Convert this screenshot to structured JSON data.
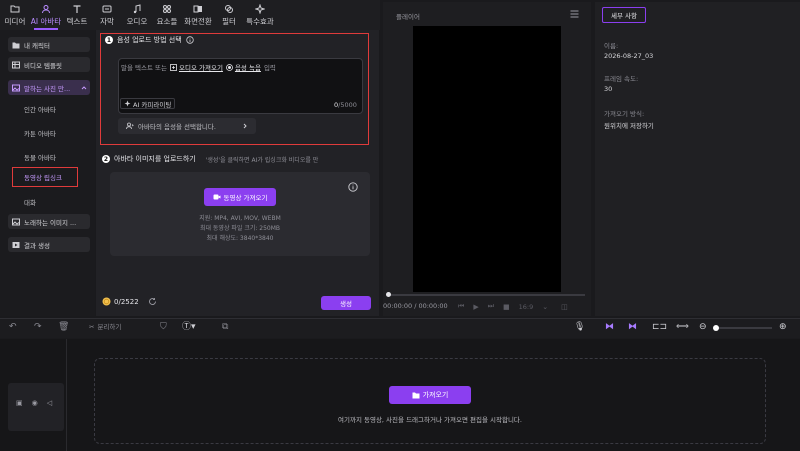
{
  "toolbar": {
    "items": [
      {
        "label": "미디어",
        "icon": "folder-icon"
      },
      {
        "label": "AI 아바타",
        "icon": "avatar-icon"
      },
      {
        "label": "텍스트",
        "icon": "text-icon"
      },
      {
        "label": "자막",
        "icon": "caption-icon"
      },
      {
        "label": "오디오",
        "icon": "music-note-icon"
      },
      {
        "label": "요소들",
        "icon": "elements-icon"
      },
      {
        "label": "화면전환",
        "icon": "transition-icon"
      },
      {
        "label": "필터",
        "icon": "filter-icon"
      },
      {
        "label": "특수효과",
        "icon": "effects-icon"
      }
    ]
  },
  "sidebar": {
    "my_character": "내 캐릭터",
    "video_template": "비디오 템플릿",
    "talking_photo": "말하는 사진 만...",
    "sub_items": [
      "인간 아바타",
      "카툰 아바타",
      "동물 아바타",
      "동영상 립싱크",
      "대화"
    ],
    "singing_image": "노래하는 이미지 ...",
    "results": "결과 생성"
  },
  "center": {
    "step1_title": "음성 업로드 방법 선택",
    "step1_num": "1",
    "step2_num": "2",
    "prompt_prefix": "말을 텍스트 또는",
    "audio_import": "오디오 가져오기",
    "record_link": "음성 녹음",
    "prompt_suffix": "입력",
    "ai_copywriting": "AI 카피라이팅",
    "char_count": "0",
    "char_limit": "/5000",
    "voice_select": "아바타의 음성을 선택합니다.",
    "step2_title": "아바타 이미지를 업로드하기",
    "step2_hint": "'생성'을 클릭하면 AI가 립싱크화 비디오를 만",
    "video_import_button": "동영상 가져오기",
    "format_info": "지원: MP4, AVI, MOV, WEBM",
    "size_info": "최대 동영상 파일 크기: 250MB",
    "resolution_info": "최대 해상도: 3840*3840",
    "credits_used": "0",
    "credits_total": "/2522",
    "generate_button": "생성"
  },
  "player": {
    "title": "플레이어",
    "time_current": "00:00:00",
    "time_total": "/ 00:00:00",
    "aspect_ratio": "16:9"
  },
  "details": {
    "tab": "세부 사항",
    "name_label": "이름:",
    "name_value": "2026-08-27_03",
    "frame_rate_label": "프레임 속도:",
    "frame_rate_value": "30",
    "import_method_label": "가져오기 방식:",
    "import_method_value": "원위치에 저장하기"
  },
  "timeline": {
    "split_label": "분리하기",
    "import_button": "가져오기",
    "drop_hint": "여기까지 동영상, 사진을 드래그하거나 가져오면 편집을 시작합니다."
  },
  "colors": {
    "accent": "#8b3ff0",
    "highlight_border": "#e03b3b",
    "active_text": "#b98cff"
  }
}
